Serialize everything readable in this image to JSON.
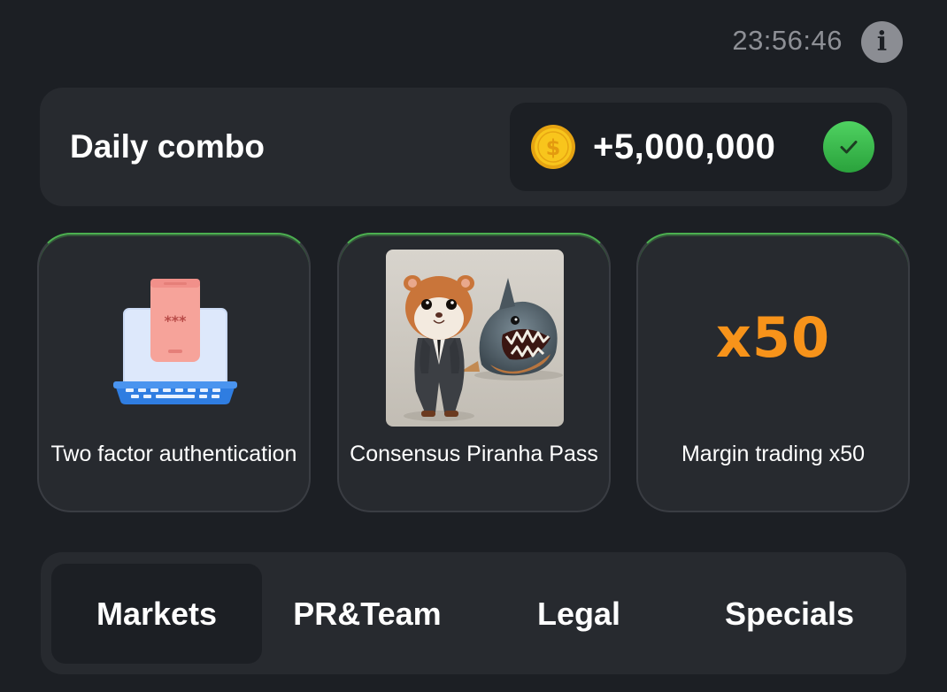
{
  "header": {
    "timer": "23:56:46",
    "info_icon": "info-icon"
  },
  "combo": {
    "title": "Daily combo",
    "reward": "+5,000,000",
    "coin_icon": "coin-icon",
    "status_icon": "check-icon"
  },
  "cards": [
    {
      "label": "Two factor authentication",
      "image": "laptop-phone-2fa-icon"
    },
    {
      "label": "Consensus Piranha Pass",
      "image": "hamster-and-piranha-photo"
    },
    {
      "label": "Margin trading x50",
      "badge": "x50"
    }
  ],
  "tabs": [
    {
      "label": "Markets",
      "active": true
    },
    {
      "label": "PR&Team",
      "active": false
    },
    {
      "label": "Legal",
      "active": false
    },
    {
      "label": "Specials",
      "active": false
    }
  ],
  "colors": {
    "background": "#1c1f24",
    "panel": "#272a2f",
    "accent_green": "#4caf50",
    "badge_orange": "#f7931a",
    "muted_text": "#8e9096"
  }
}
